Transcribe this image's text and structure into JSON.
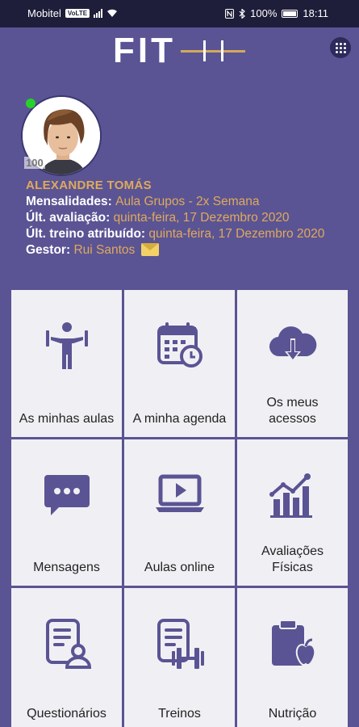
{
  "status_bar": {
    "carrier": "Mobitel",
    "volte": "VoLTE",
    "battery": "100%",
    "time": "18:11"
  },
  "brand": {
    "logo_text": "FIT",
    "accent_color": "#e0a95c",
    "background_color": "#5a5494"
  },
  "profile": {
    "avatar_badge": "100",
    "name": "ALEXANDRE TOMÁS",
    "mensalidades_label": "Mensalidades:",
    "mensalidades_value": "Aula Grupos - 2x Semana",
    "ult_avaliacao_label": "Últ. avaliação:",
    "ult_avaliacao_value": "quinta-feira, 17 Dezembro 2020",
    "ult_treino_label": "Últ. treino atribuído:",
    "ult_treino_value": "quinta-feira, 17 Dezembro 2020",
    "gestor_label": "Gestor:",
    "gestor_value": "Rui Santos"
  },
  "tiles": [
    {
      "label": "As minhas aulas",
      "icon": "fitness-person-icon"
    },
    {
      "label": "A minha agenda",
      "icon": "calendar-clock-icon"
    },
    {
      "label": "Os meus acessos",
      "icon": "cloud-download-icon"
    },
    {
      "label": "Mensagens",
      "icon": "chat-bubble-icon"
    },
    {
      "label": "Aulas online",
      "icon": "laptop-play-icon"
    },
    {
      "label": "Avaliações Físicas",
      "icon": "bar-chart-icon"
    },
    {
      "label": "Questionários",
      "icon": "document-user-icon"
    },
    {
      "label": "Treinos",
      "icon": "document-dumbbell-icon"
    },
    {
      "label": "Nutrição",
      "icon": "clipboard-apple-icon"
    }
  ]
}
